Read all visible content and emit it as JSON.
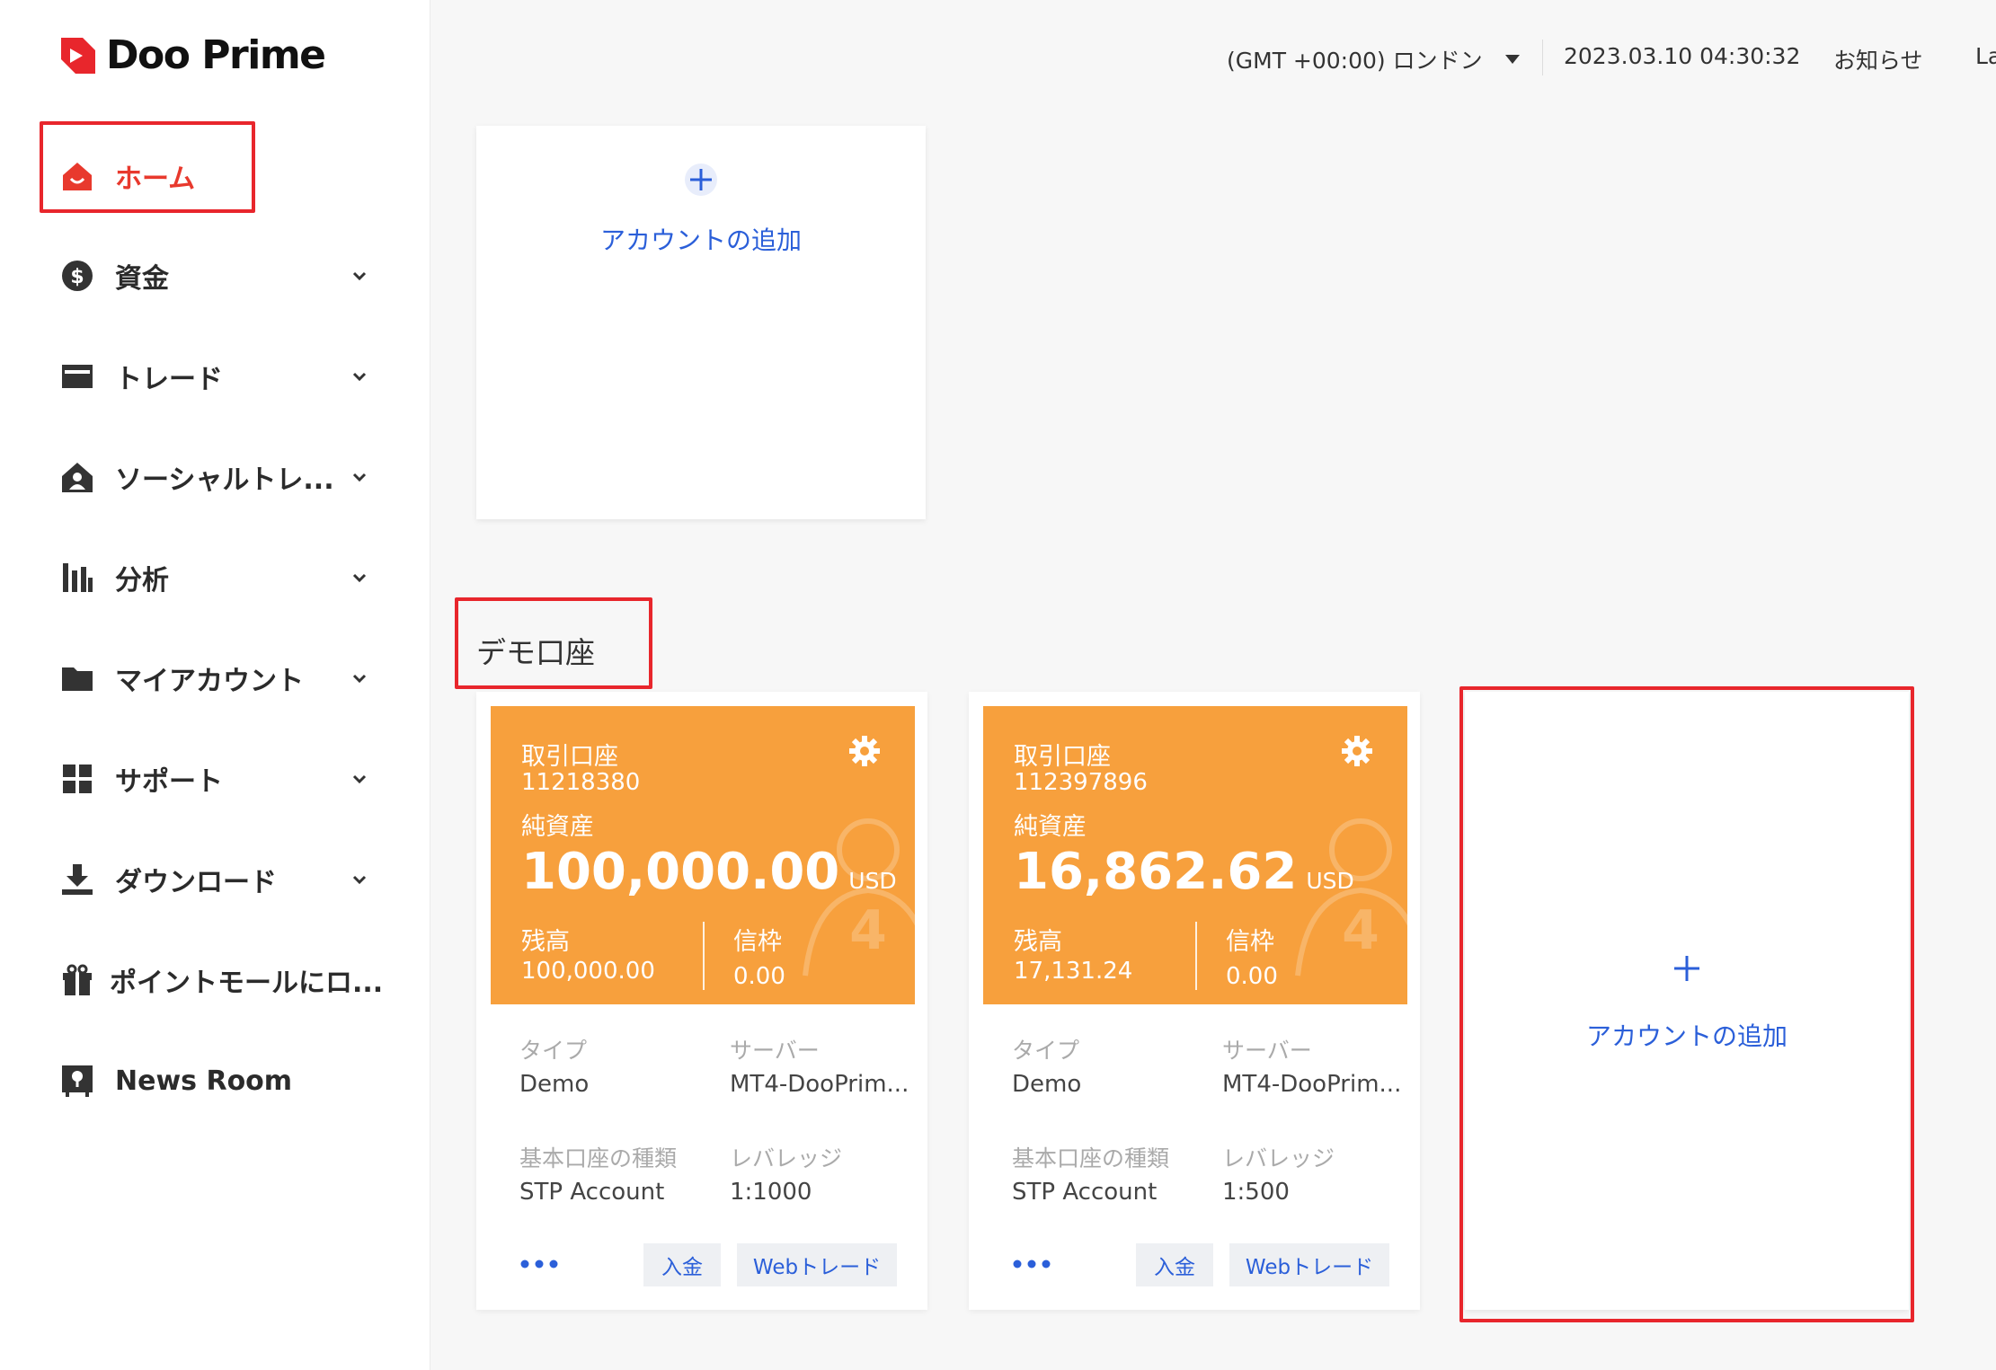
{
  "brand": {
    "name": "Doo Prime",
    "accent": "#e8392d"
  },
  "sidebar": {
    "items": [
      {
        "label": "ホーム",
        "icon": "home-icon",
        "active": true
      },
      {
        "label": "資金",
        "icon": "dollar-icon"
      },
      {
        "label": "トレード",
        "icon": "card-icon"
      },
      {
        "label": "ソーシャルトレ...",
        "icon": "social-house-icon"
      },
      {
        "label": "分析",
        "icon": "bar-chart-icon"
      },
      {
        "label": "マイアカウント",
        "icon": "folder-icon"
      },
      {
        "label": "サポート",
        "icon": "grid-icon"
      },
      {
        "label": "ダウンロード",
        "icon": "download-icon"
      },
      {
        "label": "ポイントモールにロ...",
        "icon": "gift-icon"
      },
      {
        "label": "News Room",
        "icon": "news-room-icon"
      }
    ]
  },
  "header": {
    "timezone": "(GMT +00:00) ロンドン",
    "datetime": "2023.03.10 04:30:32",
    "notifications": "お知らせ",
    "language": "La"
  },
  "live": {
    "add_account_label": "アカウントの追加"
  },
  "demo": {
    "section_title": "デモ口座",
    "add_account_label": "アカウントの追加",
    "accounts": [
      {
        "type_title": "取引口座",
        "number": "11218380",
        "equity_label": "純資産",
        "equity": "100,000.00",
        "currency": "USD",
        "balance_label": "残高",
        "balance": "100,000.00",
        "credit_label": "信枠",
        "credit": "0.00",
        "type_key": "タイプ",
        "type_val": "Demo",
        "server_key": "サーバー",
        "server_val": "MT4-DooPrim...",
        "base_key": "基本口座の種類",
        "base_val": "STP Account",
        "leverage_key": "レバレッジ",
        "leverage_val": "1:1000",
        "deposit_btn": "入金",
        "webtrade_btn": "Webトレード"
      },
      {
        "type_title": "取引口座",
        "number": "112397896",
        "equity_label": "純資産",
        "equity": "16,862.62",
        "currency": "USD",
        "balance_label": "残高",
        "balance": "17,131.24",
        "credit_label": "信枠",
        "credit": "0.00",
        "type_key": "タイプ",
        "type_val": "Demo",
        "server_key": "サーバー",
        "server_val": "MT4-DooPrim...",
        "base_key": "基本口座の種類",
        "base_val": "STP Account",
        "leverage_key": "レバレッジ",
        "leverage_val": "1:500",
        "deposit_btn": "入金",
        "webtrade_btn": "Webトレード"
      }
    ]
  },
  "colors": {
    "card_orange": "#f7a03d",
    "link_blue": "#2b5fd9",
    "highlight_red": "#e8262c"
  }
}
